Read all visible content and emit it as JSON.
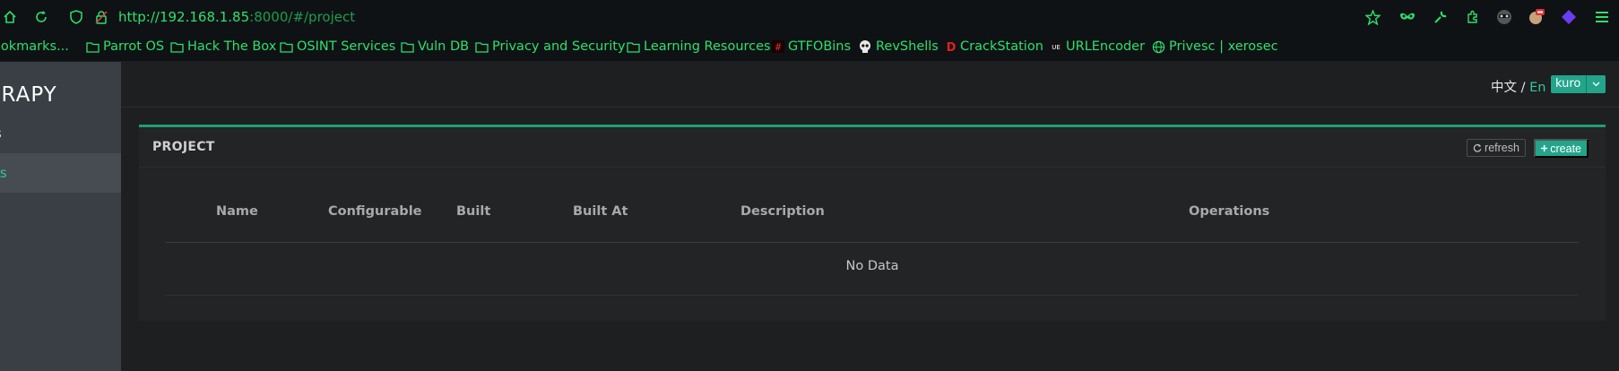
{
  "browser": {
    "url_host": "http://192.168.1.85",
    "url_rest": ":8000/#/project"
  },
  "bookmarks": [
    {
      "label": "ookmarks...",
      "icon": "folder-icon"
    },
    {
      "label": "Parrot OS",
      "icon": "folder-icon"
    },
    {
      "label": "Hack The Box",
      "icon": "folder-icon"
    },
    {
      "label": "OSINT Services",
      "icon": "folder-icon"
    },
    {
      "label": "Vuln DB",
      "icon": "folder-icon"
    },
    {
      "label": "Privacy and Security",
      "icon": "folder-icon"
    },
    {
      "label": "Learning Resources",
      "icon": "folder-icon"
    },
    {
      "label": "GTFOBins",
      "icon": "gtfobins-icon"
    },
    {
      "label": "RevShells",
      "icon": "skull-icon"
    },
    {
      "label": "CrackStation",
      "icon": "crackstation-icon"
    },
    {
      "label": "URLEncoder",
      "icon": "urlencoder-icon"
    },
    {
      "label": "Privesc | xerosec",
      "icon": "globe-icon"
    }
  ],
  "sidebar": {
    "brand": "ERAPY",
    "items": [
      {
        "label": "s"
      },
      {
        "label": "ts"
      }
    ]
  },
  "header": {
    "lang_zh": "中文",
    "lang_sep": " / ",
    "lang_en": "En",
    "user": "kuro"
  },
  "panel": {
    "title": "PROJECT",
    "refresh_label": "refresh",
    "create_label": "create"
  },
  "table": {
    "columns": [
      "Name",
      "Configurable",
      "Built",
      "Built At",
      "Description",
      "Operations"
    ],
    "empty_text": "No Data"
  },
  "colors": {
    "accent": "#22a58a",
    "url_green": "#2ee06b",
    "active_menu": "#2fc7a0"
  }
}
